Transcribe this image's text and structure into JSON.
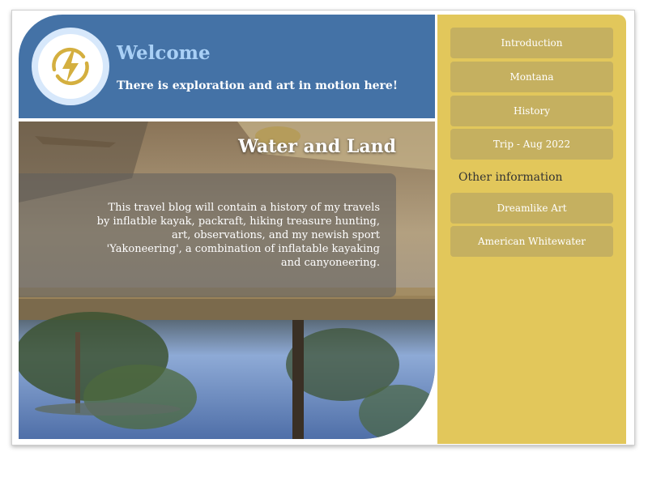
{
  "header": {
    "title": "Welcome",
    "tagline": "There is exploration and art in motion here!",
    "logo_icon": "lightning-bolt-icon"
  },
  "hero": {
    "title": "Water and Land",
    "description": "This travel blog will contain a history of my travels by inflatble kayak, packraft, hiking treasure hunting, art, observations, and my newish sport 'Yakoneering', a combination of inflatable kayaking and canyoneering."
  },
  "sidebar": {
    "nav_items": [
      {
        "label": "Introduction"
      },
      {
        "label": "Montana"
      },
      {
        "label": "History"
      },
      {
        "label": "Trip - Aug 2022"
      }
    ],
    "other_heading": "Other information",
    "other_items": [
      {
        "label": "Dreamlike Art"
      },
      {
        "label": "American Whitewater"
      }
    ]
  },
  "colors": {
    "header_bg": "#4472a6",
    "welcome_text": "#a9d0f6",
    "sidebar_bg": "#e2c75b",
    "button_bg": "#c5b060",
    "logo_bolt": "#d4af3f"
  }
}
